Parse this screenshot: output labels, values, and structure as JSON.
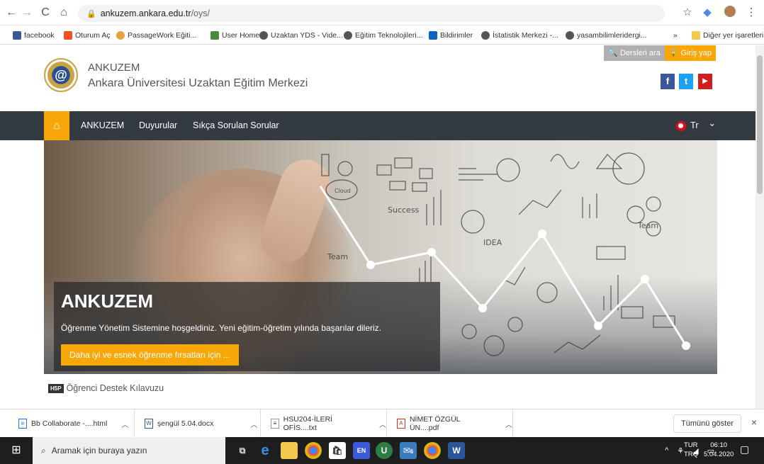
{
  "browser": {
    "url_host": "ankuzem.ankara.edu.tr",
    "url_path": "/oys/",
    "back_icon": "←",
    "forward_icon": "→",
    "reload_icon": "C",
    "home_icon": "⌂",
    "star_icon": "☆",
    "menu_icon": "⋮"
  },
  "bookmarks": [
    {
      "label": "facebook",
      "color": "#3b5998"
    },
    {
      "label": "Oturum Aç",
      "color": "#f25022"
    },
    {
      "label": "PassageWork Eğiti...",
      "color": "#e6a23c"
    },
    {
      "label": "User Home",
      "color": "#4a8a3a"
    },
    {
      "label": "Uzaktan YDS - Vide...",
      "color": "#555555"
    },
    {
      "label": "Eğitim Teknolojileri...",
      "color": "#555555"
    },
    {
      "label": "Bildirimler",
      "color": "#0a66c2"
    },
    {
      "label": "İstatistik Merkezi -...",
      "color": "#555555"
    },
    {
      "label": "yasambilimleridergi...",
      "color": "#555555"
    }
  ],
  "bookmarks_more": "»",
  "bookmarks_other": "Diğer yer işaretleri",
  "site": {
    "search_label": "Dersleri ara",
    "login_label": "Giriş yap",
    "title": "ANKUZEM",
    "subtitle": "Ankara Üniversitesi Uzaktan Eğitim Merkezi",
    "social": [
      {
        "name": "facebook",
        "glyph": "f",
        "color": "#3b5998"
      },
      {
        "name": "twitter",
        "glyph": "t",
        "color": "#1da1f2"
      },
      {
        "name": "youtube",
        "glyph": "▶",
        "color": "#cd201f"
      }
    ]
  },
  "nav": {
    "home_icon": "⌂",
    "items": [
      "ANKUZEM",
      "Duyurular",
      "Sıkça Sorulan Sorular"
    ],
    "lang": "Tr",
    "lang_chevron": "⌄"
  },
  "hero": {
    "title": "ANKUZEM",
    "text": "Öğrenme Yönetim Sistemine hoşgeldiniz. Yeni eğitim-öğretim yılında başarılar dileriz.",
    "button": "Daha iyi ve esnek öğrenme fırsatları için ...",
    "sketch_words": [
      "Success",
      "IDEA",
      "Team",
      "Team",
      "Cloud"
    ]
  },
  "support_link": "Öğrenci Destek Kılavuzu",
  "support_badge": "H5P",
  "downloads": {
    "items": [
      {
        "name": "Bb Collaborate -....html",
        "type": "html"
      },
      {
        "name": "şengül 5.04.docx",
        "type": "docx"
      },
      {
        "name": "HSU204-İLERİ OFİS....txt",
        "type": "txt"
      },
      {
        "name": "NİMET ÖZGÜL ÜN....pdf",
        "type": "pdf"
      }
    ],
    "show_all": "Tümünü göster",
    "close_icon": "×"
  },
  "taskbar": {
    "search_placeholder": "Aramak için buraya yazın",
    "lang_top": "TUR",
    "lang_bottom": "TRQ",
    "time": "06:10",
    "date": "5.04.2020",
    "badge_count": "6"
  }
}
